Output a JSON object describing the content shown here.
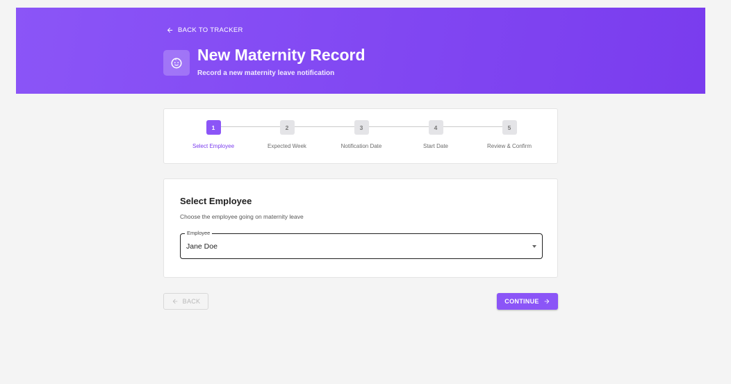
{
  "header": {
    "back_label": "BACK TO TRACKER",
    "title": "New Maternity Record",
    "subtitle": "Record a new maternity leave notification",
    "icon": "baby-face-icon"
  },
  "stepper": {
    "steps": [
      {
        "number": "1",
        "label": "Select Employee",
        "active": true
      },
      {
        "number": "2",
        "label": "Expected Week",
        "active": false
      },
      {
        "number": "3",
        "label": "Notification Date",
        "active": false
      },
      {
        "number": "4",
        "label": "Start Date",
        "active": false
      },
      {
        "number": "5",
        "label": "Review & Confirm",
        "active": false
      }
    ]
  },
  "form": {
    "title": "Select Employee",
    "subtitle": "Choose the employee going on maternity leave",
    "employee_field": {
      "label": "Employee",
      "value": "Jane Doe"
    }
  },
  "actions": {
    "back_label": "BACK",
    "continue_label": "CONTINUE"
  },
  "colors": {
    "accent": "#8b55f7",
    "banner_start": "#8b55f7",
    "banner_end": "#7a3cee"
  }
}
